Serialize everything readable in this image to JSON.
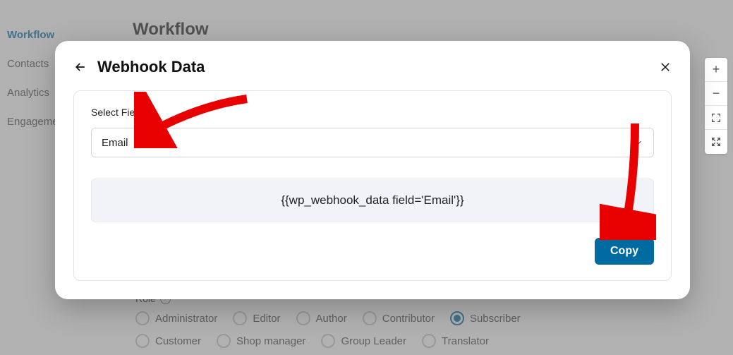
{
  "sidebar": {
    "items": [
      {
        "label": "Workflow",
        "active": true
      },
      {
        "label": "Contacts",
        "active": false
      },
      {
        "label": "Analytics",
        "active": false
      },
      {
        "label": "Engagement",
        "active": false
      }
    ]
  },
  "bg_title": "Workflow",
  "role_section": {
    "label": "Role",
    "options_row1": [
      "Administrator",
      "Editor",
      "Author",
      "Contributor",
      "Subscriber"
    ],
    "options_row2": [
      "Customer",
      "Shop manager",
      "Group Leader",
      "Translator"
    ],
    "selected": "Subscriber"
  },
  "modal": {
    "title": "Webhook Data",
    "field_label": "Select Field",
    "select_value": "Email",
    "merge_tag": "{{wp_webhook_data field='Email'}}",
    "copy_label": "Copy"
  },
  "toolbar": {
    "zoom_in": "+",
    "zoom_out": "−"
  }
}
